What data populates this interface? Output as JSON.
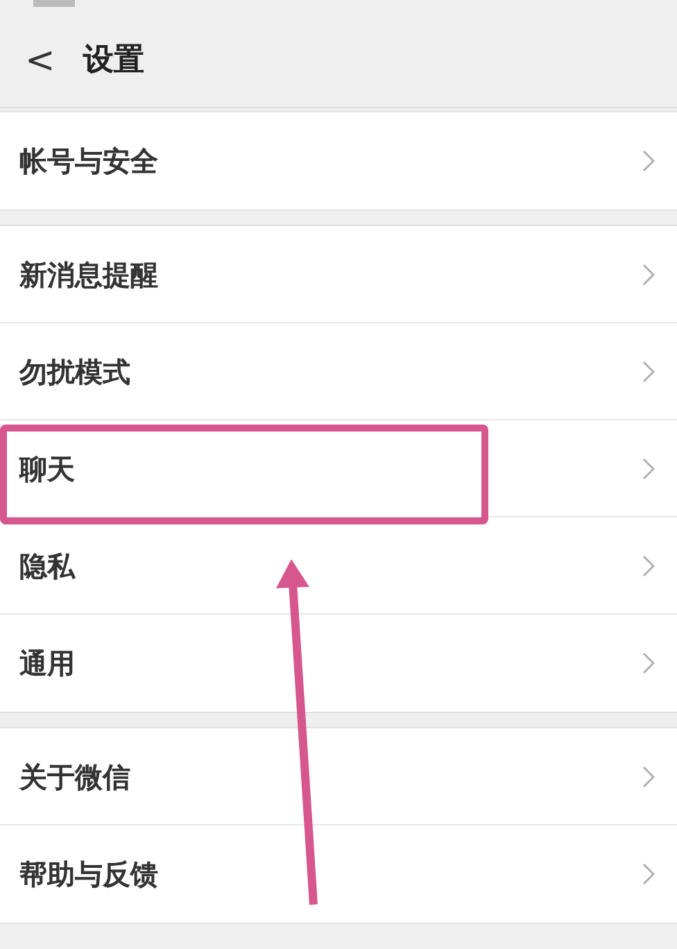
{
  "header": {
    "back": "<",
    "title": "设置"
  },
  "sections": [
    {
      "items": [
        {
          "label": "帐号与安全",
          "highlighted": false
        }
      ]
    },
    {
      "items": [
        {
          "label": "新消息提醒",
          "highlighted": false
        },
        {
          "label": "勿扰模式",
          "highlighted": false
        },
        {
          "label": "聊天",
          "highlighted": true
        },
        {
          "label": "隐私",
          "highlighted": false
        },
        {
          "label": "通用",
          "highlighted": false
        }
      ]
    },
    {
      "items": [
        {
          "label": "关于微信",
          "highlighted": false
        },
        {
          "label": "帮助与反馈",
          "highlighted": false
        }
      ]
    }
  ],
  "annotation": {
    "arrow": true
  }
}
